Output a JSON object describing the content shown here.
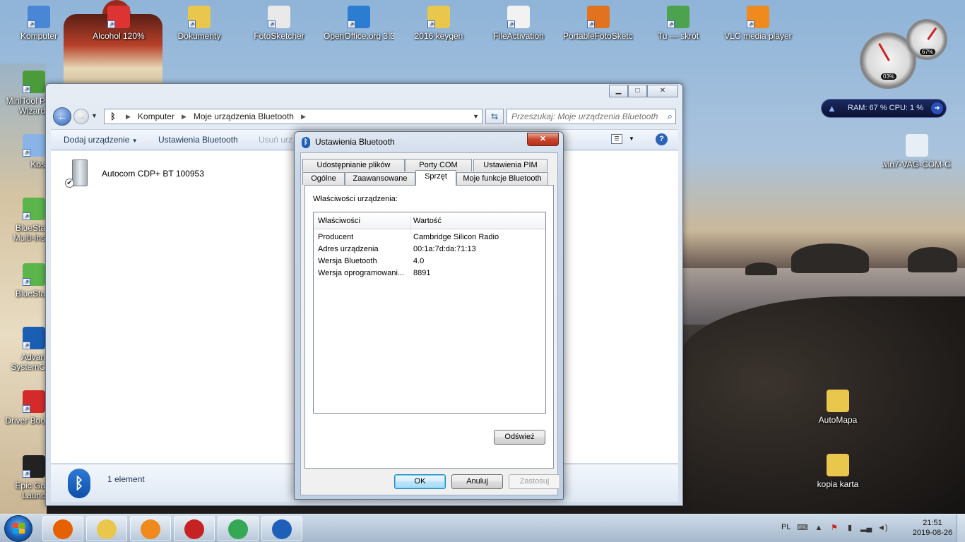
{
  "desktop": {
    "top_icons": [
      {
        "label": "Komputer",
        "icon": "computer-icon",
        "color": "#4a86d6"
      },
      {
        "label": "Alcohol 120%",
        "icon": "alcohol-icon",
        "color": "#d33"
      },
      {
        "label": "Dokumenty",
        "icon": "folder-icon",
        "color": "#e9c64c"
      },
      {
        "label": "FotoSketcher",
        "icon": "fotosketcher-icon",
        "color": "#e9e9e9"
      },
      {
        "label": "OpenOffice.org 3.3",
        "icon": "openoffice-icon",
        "color": "#2a7dd1"
      },
      {
        "label": "2016 keygen",
        "icon": "folder-icon",
        "color": "#e9c64c"
      },
      {
        "label": "FileActivation",
        "icon": "document-icon",
        "color": "#f2f2f2"
      },
      {
        "label": "PortableFotoSketc...",
        "icon": "portable-fotosketcher-icon",
        "color": "#e2731e"
      },
      {
        "label": "Tu — skrót",
        "icon": "shortcut-icon",
        "color": "#4da34d"
      },
      {
        "label": "VLC media player",
        "icon": "vlc-icon",
        "color": "#f08a1c"
      }
    ],
    "left_icons": [
      {
        "label": "MiniTool P",
        "label2": "Wizard",
        "icon": "minitool-icon",
        "color": "#4b9b3a"
      },
      {
        "label": "Kos",
        "label2": "",
        "icon": "recycle-bin-icon",
        "color": "#8ab4e8"
      },
      {
        "label": "BlueSta",
        "label2": "Multi-Ins",
        "icon": "bluestacks-icon",
        "color": "#5bb54a"
      },
      {
        "label": "BlueSta",
        "label2": "",
        "icon": "bluestacks-icon",
        "color": "#5bb54a"
      },
      {
        "label": "Advan",
        "label2": "SystemC",
        "icon": "advanced-systemcare-icon",
        "color": "#1a5fb4"
      },
      {
        "label": "Driver Boo",
        "label2": "",
        "icon": "driver-booster-icon",
        "color": "#d42a2a"
      },
      {
        "label": "Epic Ga",
        "label2": "Launc",
        "icon": "epic-games-icon",
        "color": "#222222"
      }
    ],
    "right_icons": [
      {
        "label": "win7-VAG-COM-C...",
        "icon": "vag-com-icon",
        "color": "#e8eef6"
      },
      {
        "label": "AutoMapa",
        "icon": "folder-icon",
        "color": "#e9c64c"
      },
      {
        "label": "kopia karta",
        "icon": "folder-icon",
        "color": "#e9c64c"
      }
    ],
    "gadget_cpu_percent": "03%",
    "gadget_mem_percent": "67%",
    "ramcpu_label": "RAM: 67 %  CPU: 1 %"
  },
  "explorer": {
    "breadcrumb": [
      "Komputer",
      "Moje urządzenia Bluetooth"
    ],
    "search_placeholder": "Przeszukaj: Moje urządzenia Bluetooth",
    "commands": [
      "Dodaj urządzenie",
      "Ustawienia Bluetooth",
      "Usuń urz"
    ],
    "device_name": "Autocom CDP+ BT 100953",
    "status_count": "1 element"
  },
  "dialog": {
    "title": "Ustawienia Bluetooth",
    "tabs_row1": [
      "Udostępnianie plików",
      "Porty COM",
      "Ustawienia PIM"
    ],
    "tabs_row2": [
      "Ogólne",
      "Zaawansowane",
      "Sprzęt",
      "Moje funkcje Bluetooth"
    ],
    "active_tab": "Sprzęt",
    "caption": "Właściwości urządzenia:",
    "columns": [
      "Właściwości",
      "Wartość"
    ],
    "rows": [
      [
        "Producent",
        "Cambridge Silicon Radio"
      ],
      [
        "Adres urządzenia",
        "00:1a:7d:da:71:13"
      ],
      [
        "Wersja Bluetooth",
        "4.0"
      ],
      [
        "Wersja oprogramowani...",
        "8891"
      ]
    ],
    "refresh_label": "Odśwież",
    "ok_label": "OK",
    "cancel_label": "Anuluj",
    "apply_label": "Zastosuj"
  },
  "taskbar": {
    "apps": [
      {
        "name": "firefox-icon",
        "color": "#e66000"
      },
      {
        "name": "explorer-icon",
        "color": "#e9c64c"
      },
      {
        "name": "media-player-icon",
        "color": "#f08a1c"
      },
      {
        "name": "settings-app-icon",
        "color": "#c62222"
      },
      {
        "name": "chrome-icon",
        "color": "#34a853"
      },
      {
        "name": "bluetooth-icon",
        "color": "#1e5fb8"
      }
    ],
    "language": "PL",
    "time": "21:51",
    "date": "2019-08-26"
  }
}
